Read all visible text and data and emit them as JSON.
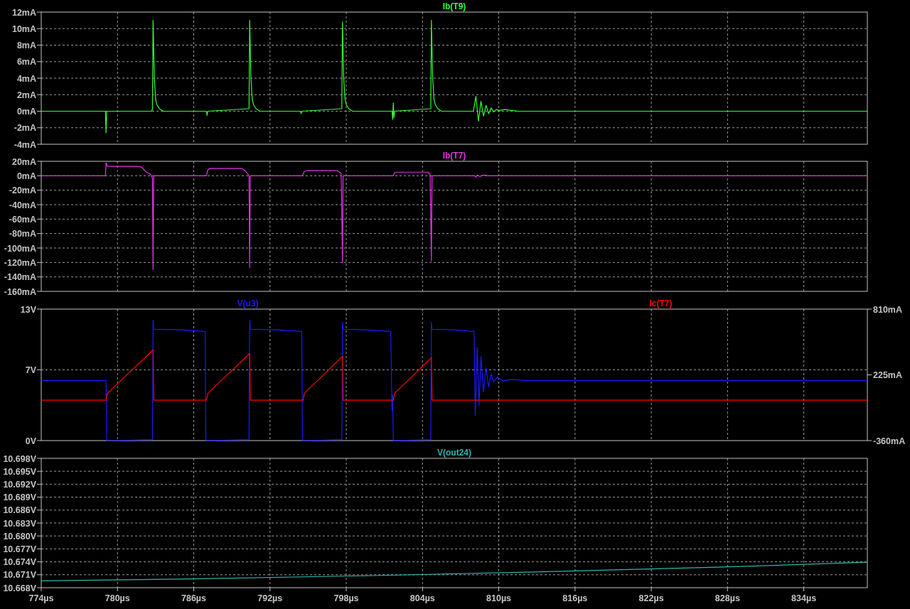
{
  "panes": [
    {
      "chart_data": {
        "type": "line",
        "grid": true,
        "xlim": [
          774,
          839
        ],
        "ylim": [
          -4,
          12
        ],
        "yticks": [
          {
            "value": 12,
            "label": "12mA"
          },
          {
            "value": 10,
            "label": "10mA"
          },
          {
            "value": 8,
            "label": "8mA"
          },
          {
            "value": 6,
            "label": "6mA"
          },
          {
            "value": 4,
            "label": "4mA"
          },
          {
            "value": 2,
            "label": "2mA"
          },
          {
            "value": 0,
            "label": "0mA"
          },
          {
            "value": -2,
            "label": "-2mA"
          },
          {
            "value": -4,
            "label": "-4mA"
          }
        ],
        "series": [
          {
            "name": "Ib(T9)",
            "color": "#33ff33",
            "x": [
              774,
              779.05,
              779.1,
              779.15,
              782.7,
              782.75,
              782.8,
              782.85,
              782.9,
              783,
              783.1,
              783.3,
              783.6,
              787,
              787.05,
              787.1,
              790.35,
              790.4,
              790.45,
              790.5,
              790.6,
              790.7,
              790.9,
              791.2,
              794.4,
              794.45,
              794.5,
              797.65,
              797.7,
              797.75,
              797.8,
              797.9,
              798,
              798.2,
              798.5,
              801.6,
              801.65,
              801.7,
              801.75,
              801.8,
              804.65,
              804.7,
              804.75,
              804.8,
              804.9,
              805,
              805.2,
              805.5,
              808,
              808.2,
              808.4,
              808.6,
              808.8,
              809,
              809.2,
              809.4,
              809.6,
              809.8,
              810,
              810.5,
              811.5,
              839
            ],
            "values": [
              0,
              0,
              -2.6,
              0,
              0,
              0.3,
              11,
              7.6,
              4,
              1.5,
              0.8,
              0.3,
              0,
              0,
              -0.5,
              0,
              0.3,
              11,
              7.5,
              4,
              1.5,
              0.8,
              0.3,
              0,
              0,
              -0.3,
              0,
              0.3,
              10.8,
              7.5,
              4,
              1.5,
              0.8,
              0.3,
              0,
              0,
              -1,
              1,
              -0.8,
              0,
              0.3,
              11,
              7.5,
              4,
              1.5,
              0.8,
              0.3,
              0,
              0,
              1.8,
              -1.2,
              1.2,
              -0.6,
              0.7,
              -0.3,
              0.4,
              -0.1,
              0.2,
              0.1,
              0.2,
              0,
              0
            ]
          }
        ]
      }
    },
    {
      "chart_data": {
        "type": "line",
        "grid": true,
        "xlim": [
          774,
          839
        ],
        "ylim": [
          -160,
          20
        ],
        "yticks": [
          {
            "value": 20,
            "label": "20mA"
          },
          {
            "value": 0,
            "label": "0mA"
          },
          {
            "value": -20,
            "label": "-20mA"
          },
          {
            "value": -40,
            "label": "-40mA"
          },
          {
            "value": -60,
            "label": "-60mA"
          },
          {
            "value": -80,
            "label": "-80mA"
          },
          {
            "value": -100,
            "label": "-100mA"
          },
          {
            "value": -120,
            "label": "-120mA"
          },
          {
            "value": -140,
            "label": "-140mA"
          },
          {
            "value": -160,
            "label": "-160mA"
          }
        ],
        "series": [
          {
            "name": "Ib(T7)",
            "color": "#e633e6",
            "x": [
              774,
              779.05,
              779.1,
              779.2,
              781.5,
              781.9,
              782.2,
              782.6,
              782.75,
              782.8,
              782.85,
              787,
              787.1,
              787.25,
              789.8,
              790.1,
              790.35,
              790.4,
              790.45,
              794.55,
              794.7,
              794.9,
              797.3,
              797.6,
              797.65,
              797.7,
              797.75,
              801.7,
              801.8,
              801.95,
              804.4,
              804.6,
              804.7,
              804.75,
              808.1,
              808.2,
              808.3,
              808.5,
              808.8,
              809.2,
              839
            ],
            "values": [
              0,
              0,
              18,
              13,
              13,
              12,
              6,
              2,
              -3,
              -130,
              0,
              0,
              8,
              10,
              10,
              6,
              0,
              -127,
              0,
              0,
              6,
              7,
              7,
              3,
              -50,
              -120,
              0,
              0,
              4,
              5,
              5,
              2,
              -118,
              0,
              0,
              -2,
              1,
              -1,
              1,
              0,
              0
            ]
          }
        ]
      }
    },
    {
      "chart_data": {
        "type": "line",
        "grid": true,
        "xlim": [
          774,
          839
        ],
        "ylim": [
          0,
          13
        ],
        "y2lim": [
          -360,
          810
        ],
        "yticks": [
          {
            "value": 13,
            "label": "13V"
          },
          {
            "value": 7,
            "label": "7V"
          },
          {
            "value": 0,
            "label": "0V"
          }
        ],
        "y2ticks": [
          {
            "value": 810,
            "label": "810mA"
          },
          {
            "value": 225,
            "label": "225mA"
          },
          {
            "value": -360,
            "label": "-360mA"
          }
        ],
        "series": [
          {
            "name": "V(u3)",
            "color": "#1a1aff",
            "x": [
              774,
              779.1,
              779.15,
              782.75,
              782.8,
              782.85,
              785,
              786.9,
              786.95,
              790.35,
              790.4,
              790.45,
              792.5,
              794.5,
              794.55,
              797.65,
              797.7,
              797.75,
              799.5,
              801.5,
              801.6,
              801.65,
              801.7,
              804.65,
              804.7,
              804.75,
              806.5,
              808.05,
              808.15,
              808.3,
              808.45,
              808.6,
              808.8,
              809,
              809.2,
              809.4,
              809.6,
              809.9,
              810.3,
              811,
              812,
              839
            ],
            "values": [
              5.95,
              5.95,
              0,
              0.1,
              11.9,
              11,
              10.95,
              10.8,
              0,
              0.1,
              11.9,
              11,
              10.95,
              10.8,
              0,
              0.1,
              11.7,
              11,
              10.95,
              10.8,
              3,
              4.5,
              0,
              0.1,
              11.7,
              11,
              10.95,
              10.8,
              2.5,
              9.2,
              3.5,
              8.3,
              4.8,
              7.2,
              5.3,
              6.6,
              5.8,
              6.3,
              5.9,
              6.05,
              5.95,
              5.95
            ]
          },
          {
            "name": "Ic(T7)",
            "color": "#ff0000",
            "axis": "y2",
            "x": [
              774,
              779.1,
              779.2,
              782.8,
              782.85,
              787,
              787.1,
              790.4,
              790.45,
              794.6,
              794.7,
              797.7,
              797.75,
              801.7,
              801.8,
              804.7,
              804.75,
              839
            ],
            "values": [
              0,
              0,
              60,
              446,
              0,
              0,
              60,
              415,
              0,
              0,
              60,
              390,
              0,
              0,
              60,
              378,
              0,
              0
            ]
          }
        ]
      }
    },
    {
      "chart_data": {
        "type": "line",
        "grid": true,
        "xlim": [
          774,
          839
        ],
        "ylim": [
          10.668,
          10.698
        ],
        "xticks": [
          {
            "value": 774,
            "label": "774µs"
          },
          {
            "value": 780,
            "label": "780µs"
          },
          {
            "value": 786,
            "label": "786µs"
          },
          {
            "value": 792,
            "label": "792µs"
          },
          {
            "value": 798,
            "label": "798µs"
          },
          {
            "value": 804,
            "label": "804µs"
          },
          {
            "value": 810,
            "label": "810µs"
          },
          {
            "value": 816,
            "label": "816µs"
          },
          {
            "value": 822,
            "label": "822µs"
          },
          {
            "value": 828,
            "label": "828µs"
          },
          {
            "value": 834,
            "label": "834µs"
          }
        ],
        "yticks": [
          {
            "value": 10.698,
            "label": "10.698V"
          },
          {
            "value": 10.695,
            "label": "10.695V"
          },
          {
            "value": 10.692,
            "label": "10.692V"
          },
          {
            "value": 10.689,
            "label": "10.689V"
          },
          {
            "value": 10.686,
            "label": "10.686V"
          },
          {
            "value": 10.683,
            "label": "10.683V"
          },
          {
            "value": 10.68,
            "label": "10.680V"
          },
          {
            "value": 10.677,
            "label": "10.677V"
          },
          {
            "value": 10.674,
            "label": "10.674V"
          },
          {
            "value": 10.671,
            "label": "10.671V"
          },
          {
            "value": 10.668,
            "label": "10.668V"
          }
        ],
        "series": [
          {
            "name": "V(out24)",
            "color": "#2fb7b0",
            "x": [
              774,
              785,
              800,
              815,
              830,
              839
            ],
            "values": [
              10.6696,
              10.67,
              10.6708,
              10.6718,
              10.673,
              10.6739
            ]
          }
        ]
      }
    }
  ]
}
